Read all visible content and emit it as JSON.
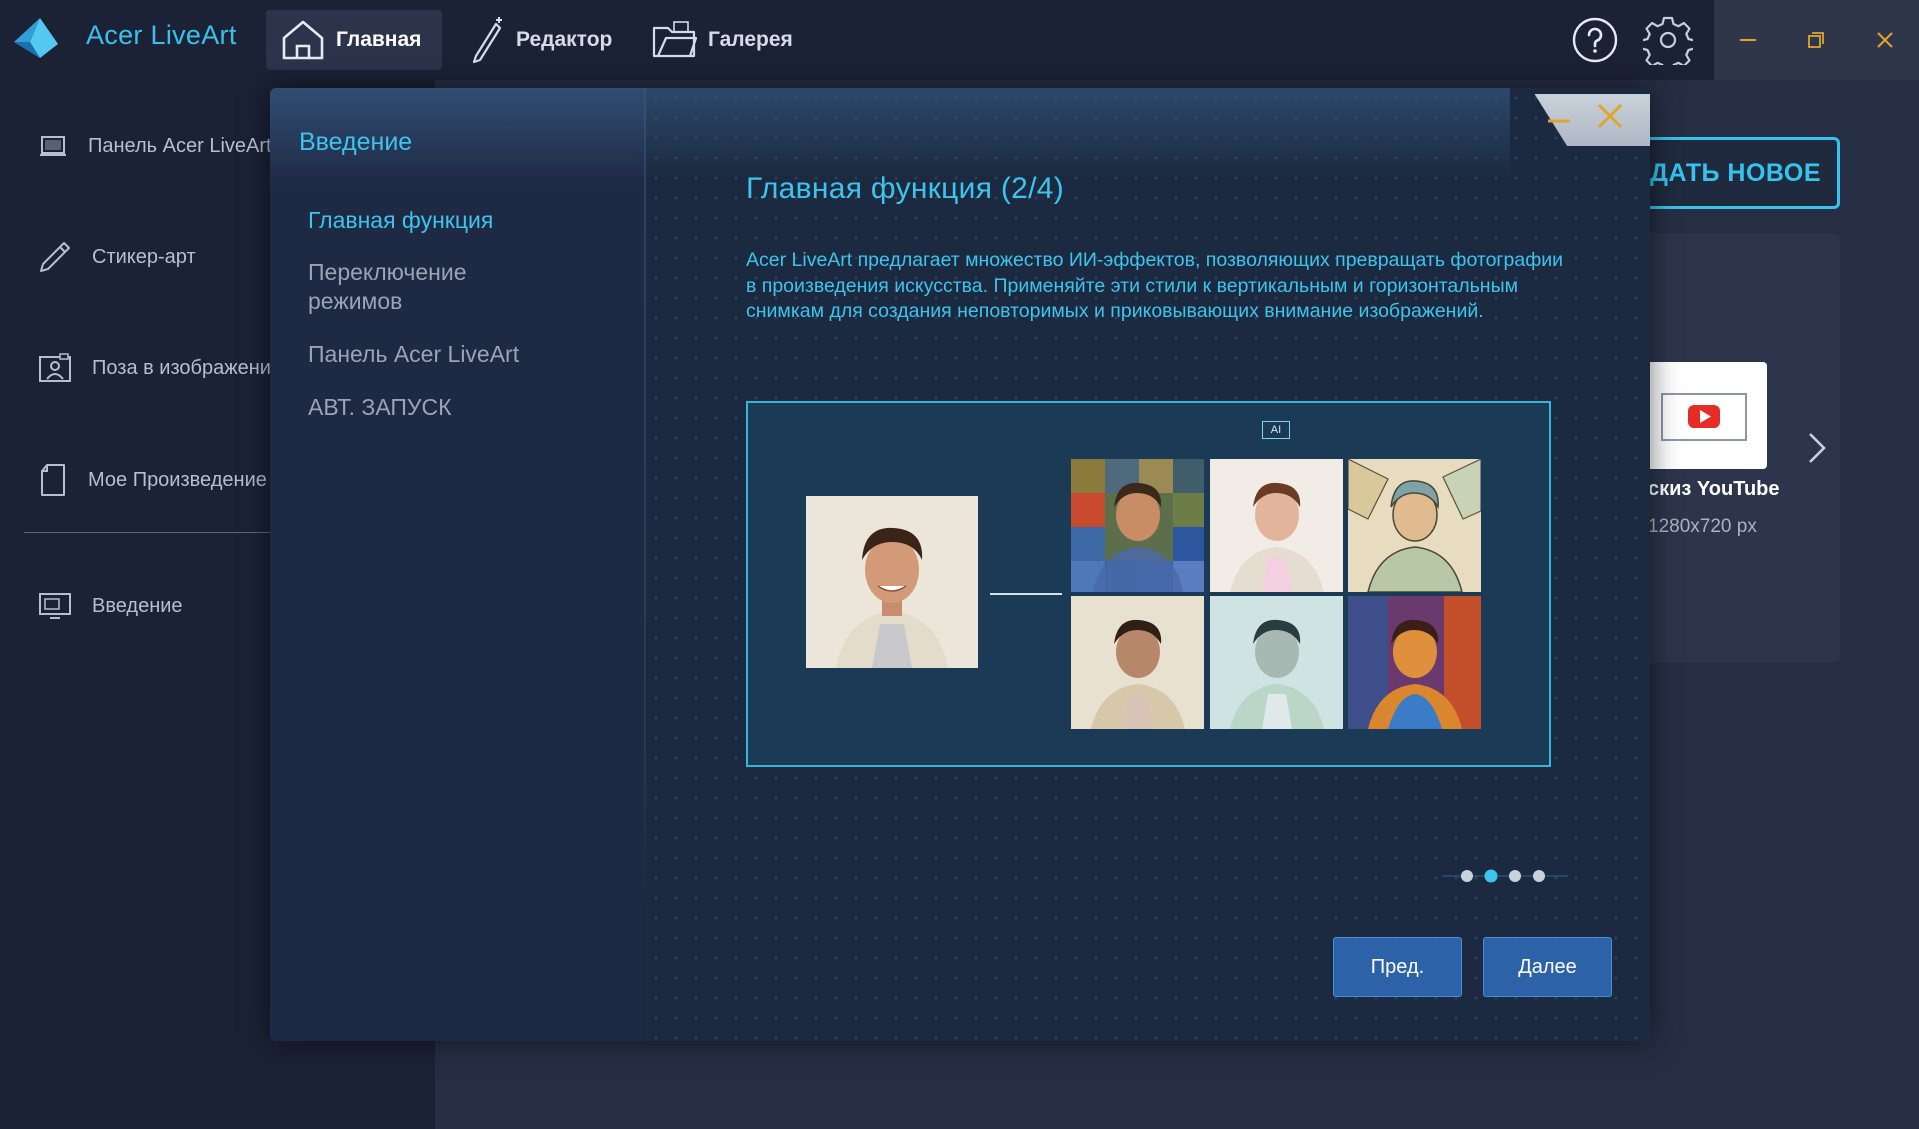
{
  "window": {
    "app_title": "Acer LiveArt"
  },
  "top_nav": {
    "tabs": [
      {
        "label": "Главная",
        "icon": "home-icon",
        "active": true
      },
      {
        "label": "Редактор",
        "icon": "magic-wand-icon",
        "active": false
      },
      {
        "label": "Галерея",
        "icon": "folder-images-icon",
        "active": false
      }
    ]
  },
  "sidebar": {
    "items": [
      {
        "label": "Панель Acer LiveArt",
        "icon": "monitor-frame-icon"
      },
      {
        "label": "Стикер-арт",
        "icon": "pen-icon"
      },
      {
        "label": "Поза в изображении",
        "icon": "person-photo-icon"
      },
      {
        "label": "Мое Произведение",
        "icon": "document-icon"
      },
      {
        "label": "Введение",
        "icon": "presentation-icon"
      }
    ]
  },
  "main": {
    "create_button": "ЗДАТЬ НОВОЕ",
    "template": {
      "caption": "скиз YouTube",
      "size": "1280x720 px"
    }
  },
  "dialog": {
    "heading": "Введение",
    "nav_items": [
      {
        "label": "Главная функция",
        "active": true
      },
      {
        "label": "Переключение режимов",
        "active": false
      },
      {
        "label": "Панель Acer LiveArt",
        "active": false
      },
      {
        "label": "АВТ. ЗАПУСК",
        "active": false
      }
    ],
    "title": "Главная функция (2/4)",
    "description": "Acer LiveArt предлагает множество ИИ-эффектов, позволяющих превращать фотографии в произведения искусства. Применяйте эти стили к вертикальным и горизонтальным снимкам для создания неповторимых и приковывающих внимание изображений.",
    "ai_badge": "AI",
    "pager": {
      "total": 4,
      "current": 2
    },
    "prev_button": "Пред.",
    "next_button": "Далее"
  },
  "colors": {
    "accent": "#3ec4ec",
    "button_blue": "#2c62a8",
    "topbar_bg": "#1b2236",
    "dialog_bg": "#1d2740"
  }
}
